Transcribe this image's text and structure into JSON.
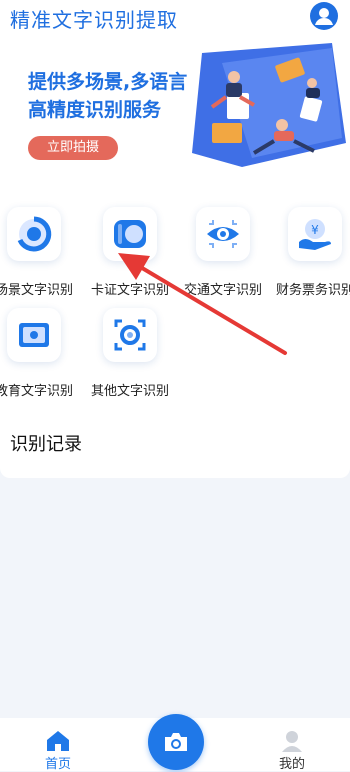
{
  "app": {
    "title": "精准文字识别提取"
  },
  "banner": {
    "line1": "提供多场景,多语言",
    "line2": "高精度识别服务",
    "button_label": "立即拍摄"
  },
  "features": [
    {
      "label": "场景文字识别",
      "icon": "scene-ocr-icon"
    },
    {
      "label": "卡证文字识别",
      "icon": "card-ocr-icon"
    },
    {
      "label": "交通文字识别",
      "icon": "traffic-ocr-icon"
    },
    {
      "label": "财务票务识别",
      "icon": "finance-ocr-icon"
    },
    {
      "label": "教育文字识别",
      "icon": "education-ocr-icon"
    },
    {
      "label": "其他文字识别",
      "icon": "other-ocr-icon"
    }
  ],
  "records": {
    "title": "识别记录"
  },
  "tabbar": {
    "home_label": "首页",
    "mine_label": "我的",
    "active": "home"
  },
  "colors": {
    "primary": "#1f6fe0",
    "accent": "#e4695b",
    "annotation_arrow": "#e53935"
  }
}
